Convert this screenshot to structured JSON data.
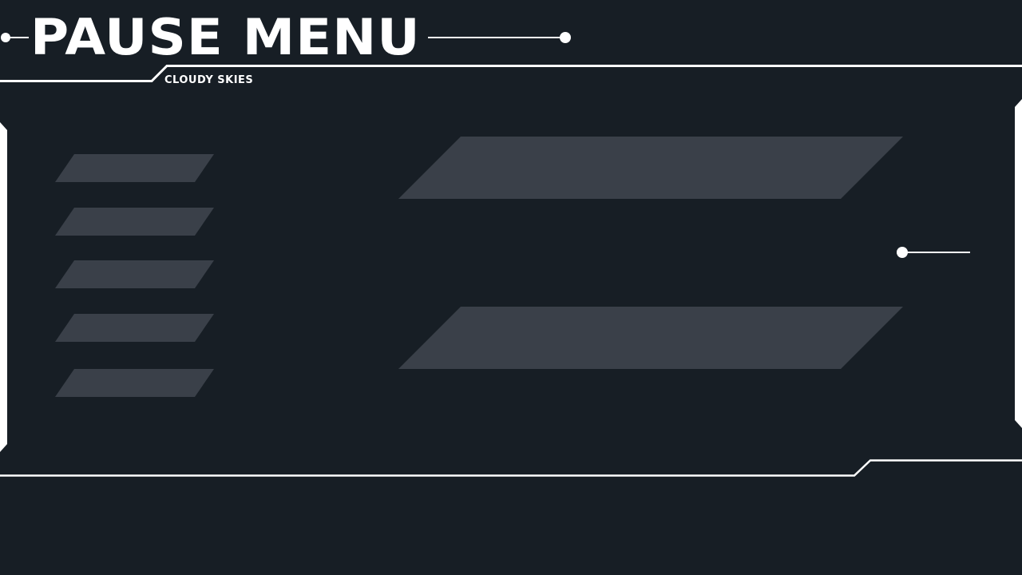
{
  "header": {
    "title": "PAUSE MENU",
    "subtitle": "CLOUDY SKIES"
  },
  "menu": {
    "items": [
      {
        "label": ""
      },
      {
        "label": ""
      },
      {
        "label": ""
      },
      {
        "label": ""
      },
      {
        "label": ""
      }
    ]
  },
  "panels": [
    {
      "label": ""
    },
    {
      "label": ""
    }
  ],
  "colors": {
    "background": "#171e25",
    "accent": "#ffffff",
    "button": "#3a4049"
  }
}
